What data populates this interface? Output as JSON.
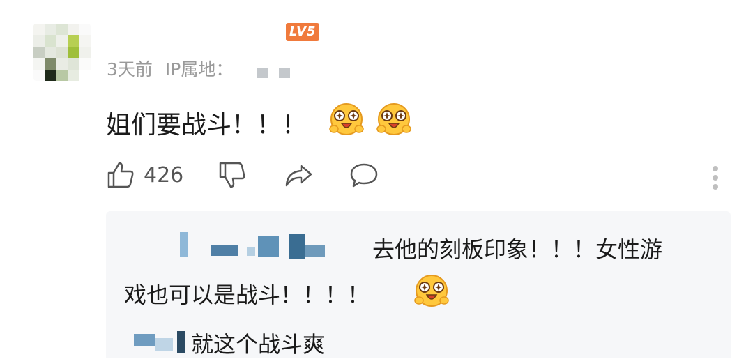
{
  "comment": {
    "username": "",
    "level_badge": "LV5",
    "timestamp": "3天前",
    "ip_label": "IP属地：",
    "text": "姐们要战斗！！！",
    "emojis": [
      "starry-eyed-emoji",
      "starry-eyed-emoji"
    ],
    "like_count": "426"
  },
  "actions": {
    "icons": [
      "thumbs-up-icon",
      "thumbs-down-icon",
      "share-icon",
      "comment-icon",
      "more-icon"
    ]
  },
  "replies": [
    {
      "line1": "去他的刻板印象！！！女性游",
      "line2": "戏也可以是战斗！！！！",
      "emoji": "starry-eyed-emoji"
    },
    {
      "text": "就这个战斗爽"
    }
  ],
  "colors": {
    "badge": "#f07a3c",
    "meta_text": "#9a9a9a",
    "reply_bg": "#f6f7f9",
    "icon": "#555555"
  }
}
